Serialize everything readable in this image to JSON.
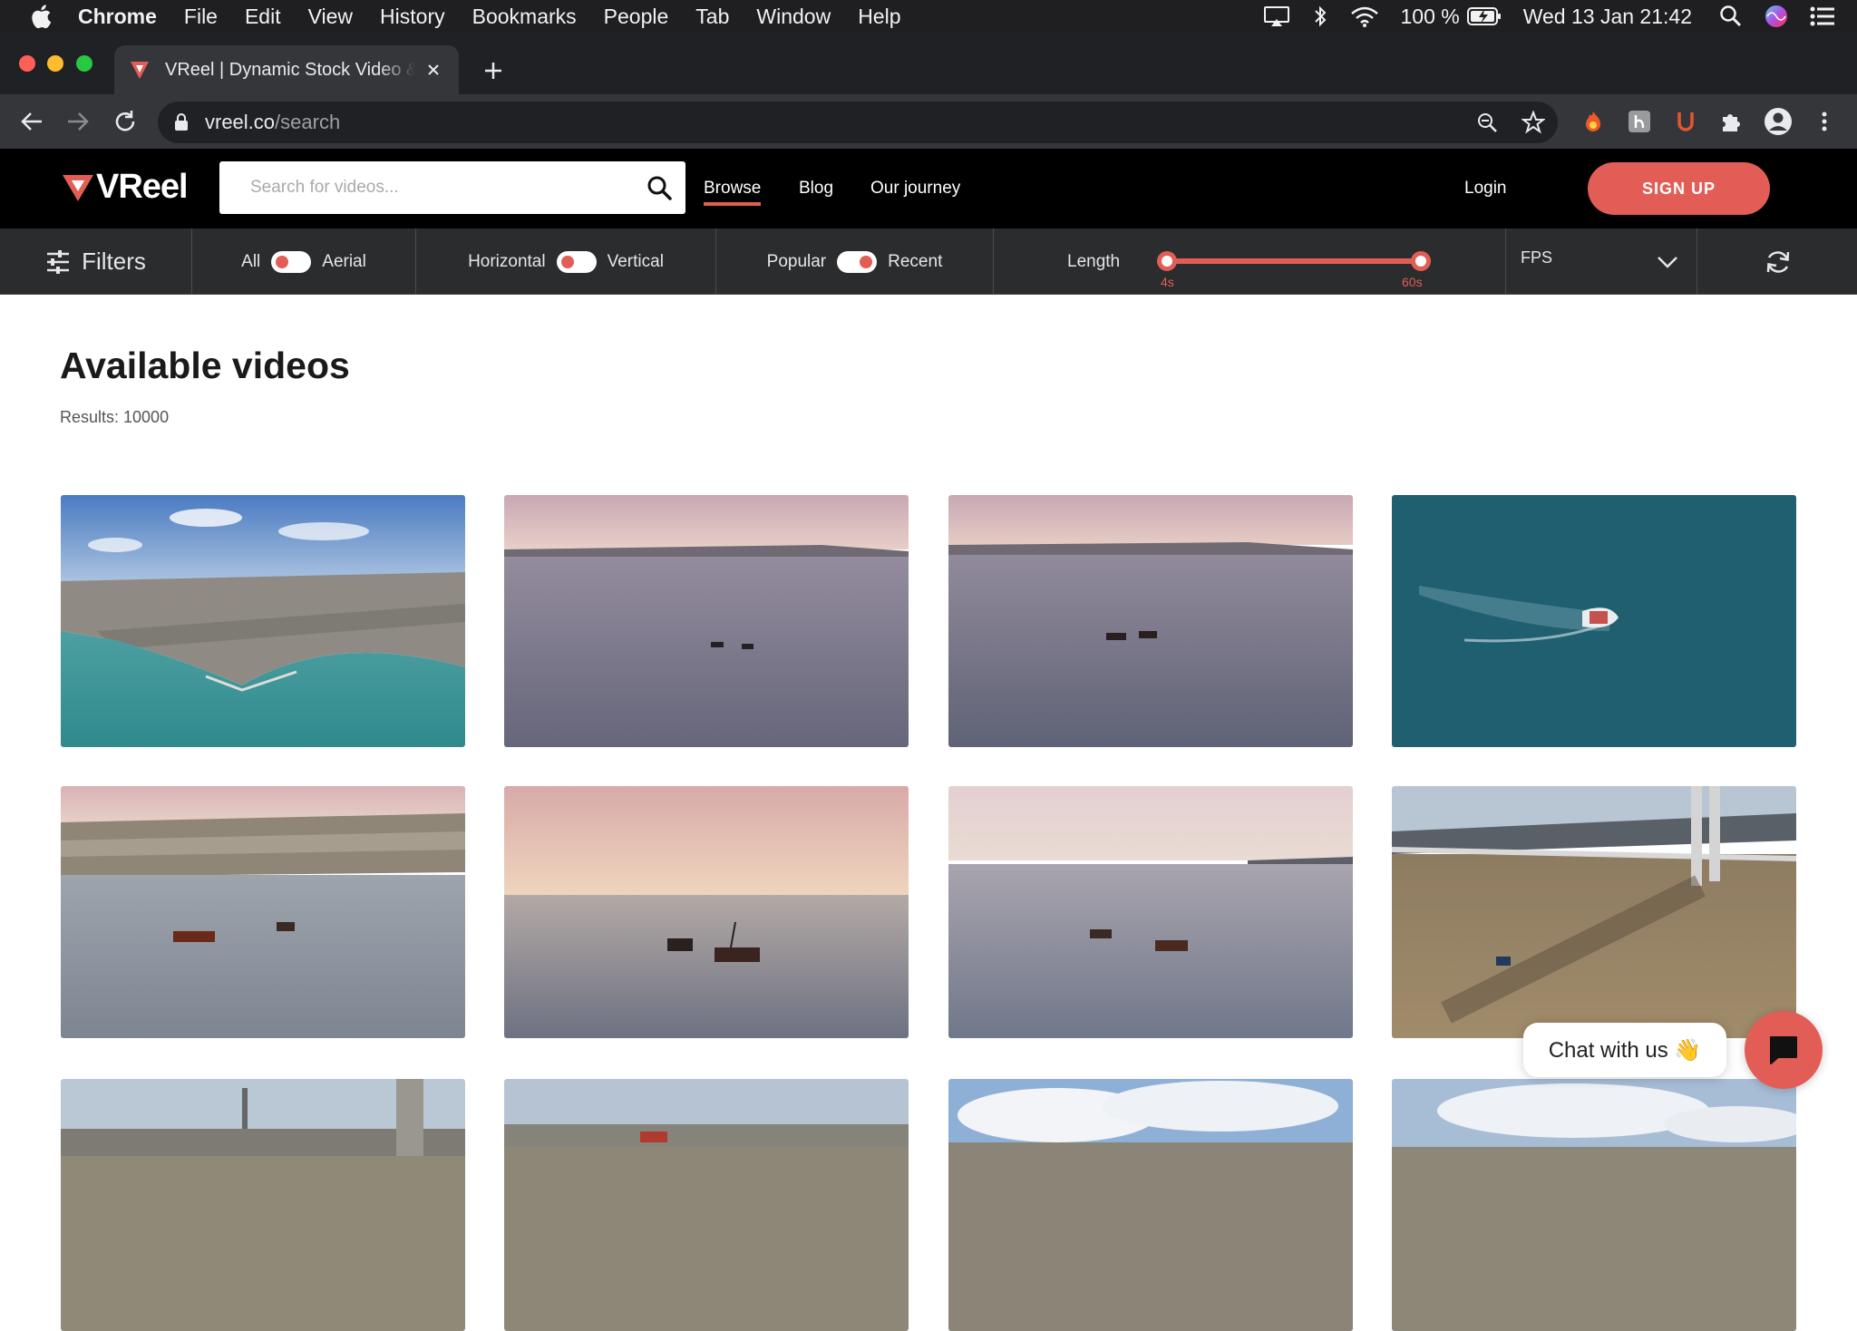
{
  "menubar": {
    "app": "Chrome",
    "items": [
      "File",
      "Edit",
      "View",
      "History",
      "Bookmarks",
      "People",
      "Tab",
      "Window",
      "Help"
    ],
    "battery": "100 %",
    "datetime": "Wed 13 Jan  21:42"
  },
  "browser": {
    "tab_title": "VReel | Dynamic Stock Video & Footage",
    "url_host": "vreel.co",
    "url_path": "/search"
  },
  "site": {
    "logo": "VReel",
    "search_placeholder": "Search for videos...",
    "nav": [
      "Browse",
      "Blog",
      "Our journey"
    ],
    "login": "Login",
    "signup": "SIGN UP",
    "accent": "#e25d55"
  },
  "filters": {
    "label": "Filters",
    "toggle1": {
      "left": "All",
      "right": "Aerial"
    },
    "toggle2": {
      "left": "Horizontal",
      "right": "Vertical"
    },
    "toggle3": {
      "left": "Popular",
      "right": "Recent"
    },
    "length_label": "Length",
    "length_min": "4s",
    "length_max": "60s",
    "fps_label": "FPS"
  },
  "content": {
    "title": "Available videos",
    "results": "Results: 10000"
  },
  "chat": {
    "label": "Chat with us 👋"
  }
}
